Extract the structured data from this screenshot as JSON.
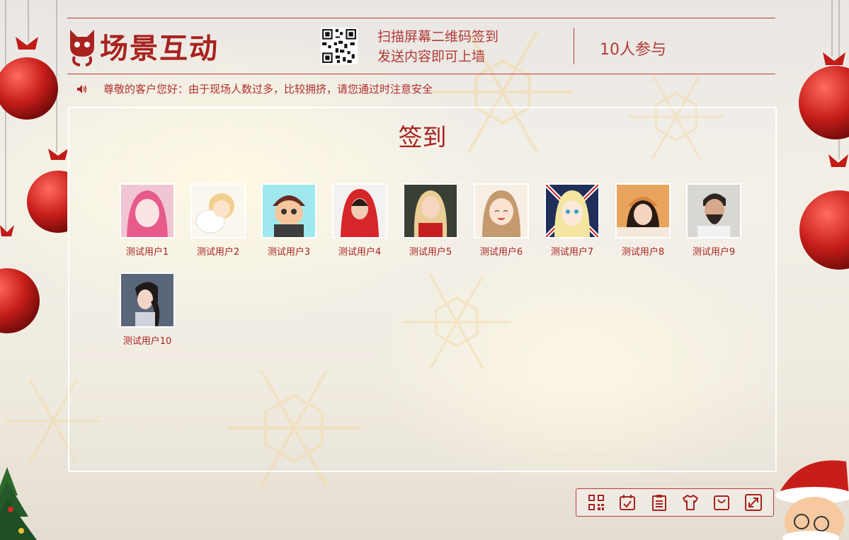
{
  "brand": {
    "name": "场景互动"
  },
  "header": {
    "scan_line1": "扫描屏幕二维码签到",
    "scan_line2": "发送内容即可上墙",
    "participants": "10人参与"
  },
  "notice": {
    "text": "尊敬的客户您好：由于现场人数过多，比较拥挤，请您通过时注意安全"
  },
  "panel": {
    "title": "签到"
  },
  "users": [
    {
      "name": "测试用户1"
    },
    {
      "name": "测试用户2"
    },
    {
      "name": "测试用户3"
    },
    {
      "name": "测试用户4"
    },
    {
      "name": "测试用户5"
    },
    {
      "name": "测试用户6"
    },
    {
      "name": "测试用户7"
    },
    {
      "name": "测试用户8"
    },
    {
      "name": "测试用户9"
    },
    {
      "name": "测试用户10"
    }
  ],
  "toolbar": {
    "icons": [
      "qr-code-icon",
      "calendar-check-icon",
      "clipboard-list-icon",
      "shirt-icon",
      "shopping-bag-icon",
      "fullscreen-icon"
    ]
  },
  "colors": {
    "accent": "#a8231f",
    "line": "#b83a3a"
  }
}
